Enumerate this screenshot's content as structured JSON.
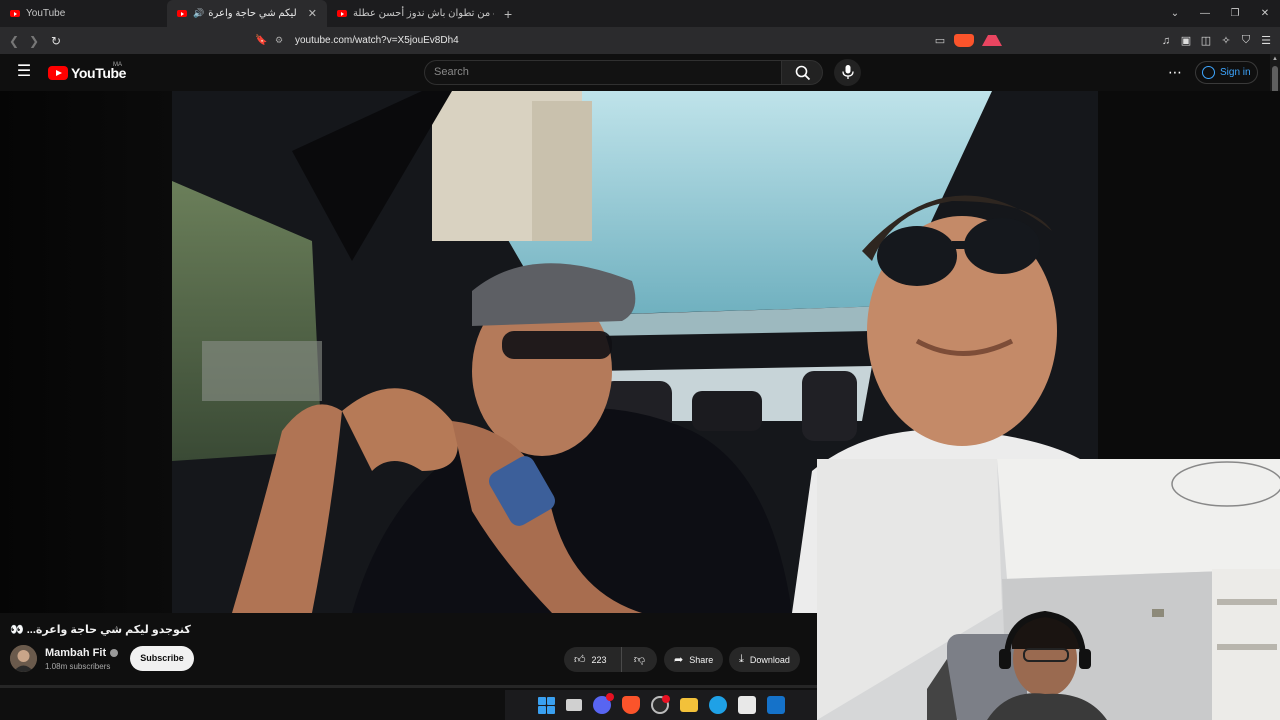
{
  "browser": {
    "tabs": [
      {
        "title": "YouTube",
        "active": false
      },
      {
        "title": "كنوجدو ليكم شي حاجة واعرة...",
        "active": true
      },
      {
        "title": "سافرت من تطوان باش ندوز أحسن عطلة",
        "active": false
      }
    ],
    "new_tab_glyph": "+",
    "url": "youtube.com/watch?v=X5jouEv8Dh4",
    "window_controls": [
      "⌄",
      "—",
      "❐",
      "✕"
    ]
  },
  "youtube": {
    "logo_text": "YouTube",
    "country_code": "MA",
    "search_placeholder": "Search",
    "signin_label": "Sign in",
    "video": {
      "title": "👀 ...كنوجدو ليكم شي حاجة واعرة",
      "channel_name": "Mambah Fit",
      "subscribers": "1.08m subscribers",
      "subscribe_label": "Subscribe",
      "likes": "223",
      "share_label": "Share",
      "download_label": "Download"
    }
  },
  "icons": {
    "menu": "hamburger-icon",
    "search": "search-icon",
    "mic": "microphone-icon",
    "more": "more-vert-icon",
    "like": "thumbs-up-icon",
    "dislike": "thumbs-down-icon",
    "share": "share-icon",
    "download": "download-icon"
  },
  "colors": {
    "youtube_red": "#ff0000",
    "link_blue": "#3ea6ff",
    "background": "#0f0f0f"
  }
}
